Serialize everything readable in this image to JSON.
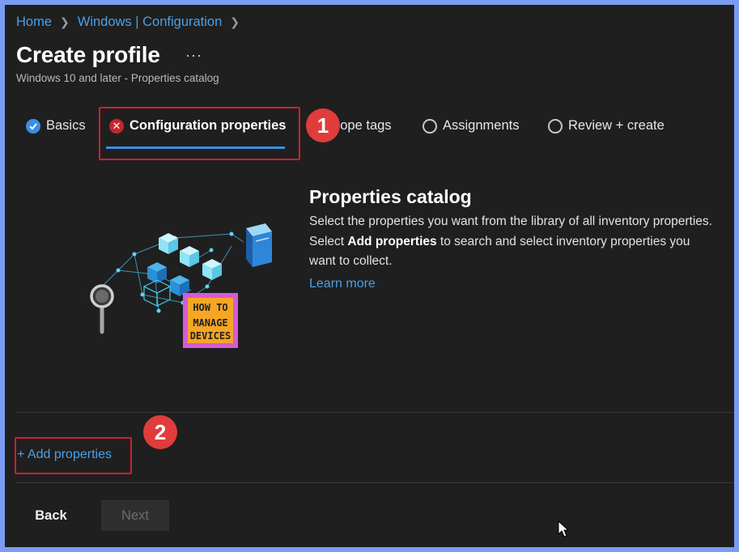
{
  "breadcrumb": {
    "home": "Home",
    "section": "Windows | Configuration"
  },
  "page": {
    "title": "Create profile",
    "more": "···",
    "subtitle": "Windows 10 and later - Properties catalog"
  },
  "tabs": [
    {
      "label": "Basics",
      "state": "complete"
    },
    {
      "label": "Configuration properties",
      "state": "error"
    },
    {
      "label": "cope tags",
      "state": "pending"
    },
    {
      "label": "Assignments",
      "state": "pending"
    },
    {
      "label": "Review + create",
      "state": "pending"
    }
  ],
  "annotations": {
    "one": "1",
    "two": "2"
  },
  "logo": {
    "line1": "HOW TO",
    "line2": "MANAGE",
    "line3": "DEVICES"
  },
  "catalog": {
    "title": "Properties catalog",
    "desc_before": "Select the properties you want from the library of all inventory properties. Select ",
    "desc_bold": "Add properties",
    "desc_after": " to search and select inventory properties you want to collect.",
    "learn_more": "Learn more"
  },
  "actions": {
    "add_properties": "+ Add properties",
    "back": "Back",
    "next": "Next"
  },
  "colors": {
    "accent": "#4aa0e6",
    "error": "#c4262e",
    "highlight": "#d0202a",
    "background": "#1f1f1f"
  }
}
